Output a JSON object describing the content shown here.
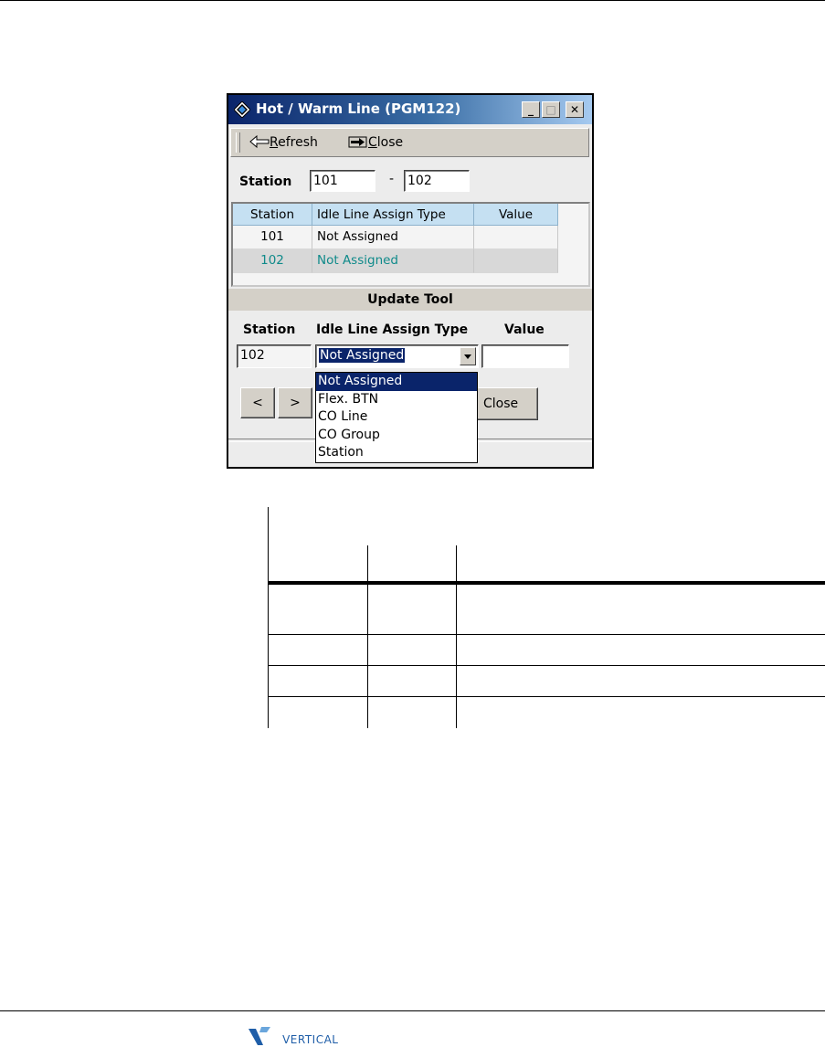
{
  "window": {
    "title": "Hot / Warm Line (PGM122)",
    "icon": "app-diamond-icon",
    "controls": {
      "minimize": "_",
      "maximize": "□",
      "close": "✕"
    }
  },
  "toolbar": {
    "refresh_label_rest": "efresh",
    "refresh_label_accel": "R",
    "close_label_rest": "lose",
    "close_label_accel": "C"
  },
  "station_range": {
    "label": "Station",
    "from": "101",
    "separator": "-",
    "to": "102"
  },
  "grid": {
    "columns": [
      "Station",
      "Idle Line Assign Type",
      "Value"
    ],
    "rows": [
      {
        "station": "101",
        "type": "Not Assigned",
        "value": ""
      },
      {
        "station": "102",
        "type": "Not Assigned",
        "value": ""
      }
    ],
    "selected_row_color": "#0f8a8a"
  },
  "update_tool": {
    "title": "Update Tool",
    "labels": {
      "station": "Station",
      "type": "Idle Line Assign Type",
      "value": "Value"
    },
    "station_value": "102",
    "type_selected": "Not Assigned",
    "value": "",
    "options": [
      "Not Assigned",
      "Flex. BTN",
      "CO Line",
      "CO Group",
      "Station"
    ],
    "prev_label": "<",
    "next_label": ">",
    "close_label": "Close"
  },
  "footer": {
    "logo_text": "VERTICAL"
  },
  "colors": {
    "title_bar_start": "#0a246a",
    "title_bar_end": "#a6caf0",
    "grid_header": "#c5e0f2",
    "selection": "#0a246a"
  }
}
